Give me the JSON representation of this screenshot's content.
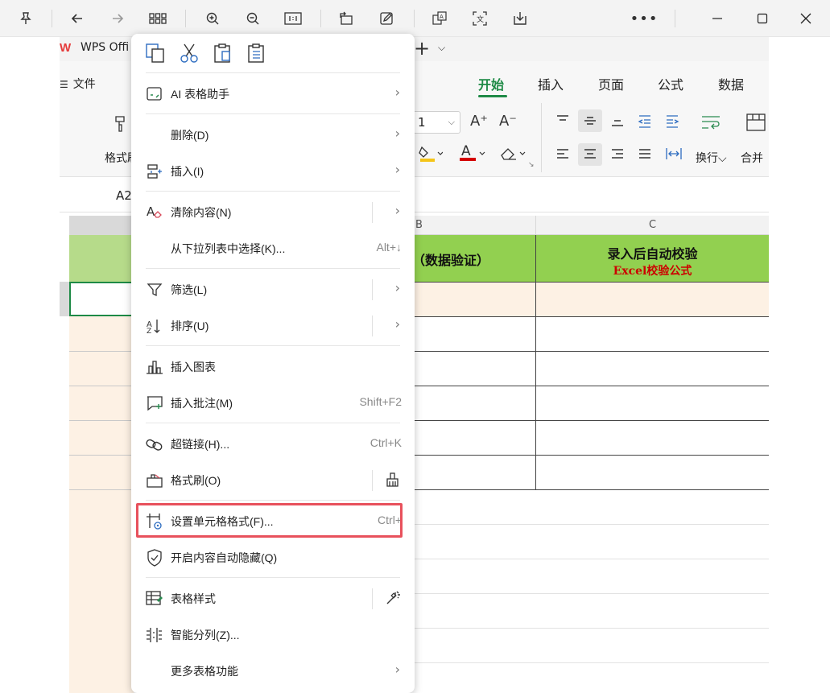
{
  "viewer": {
    "icons": [
      "pin-icon",
      "back-icon",
      "forward-icon",
      "grid-icon",
      "zoom-in-icon",
      "zoom-out-icon",
      "actual-size-icon",
      "rotate-icon",
      "edit-icon",
      "translate-icon",
      "ocr-icon",
      "save-icon",
      "more-icon"
    ]
  },
  "app": {
    "tab_label": "WPS Offi",
    "file_menu": "文件",
    "ribbon_tabs": [
      "开始",
      "插入",
      "页面",
      "公式",
      "数据"
    ],
    "active_tab": "开始",
    "format_painter_label": "格式刷",
    "font_size": "1",
    "wrap_label": "换行",
    "merge_label": "合并",
    "name_box": "A2"
  },
  "grid": {
    "columns": [
      "B",
      "C"
    ],
    "header_b": "（数据验证）",
    "header_c_title": "录入后自动校验",
    "header_c_sub": "Excel校验公式"
  },
  "context_menu": {
    "items": [
      {
        "label": "AI 表格助手",
        "icon": "ai-assistant-icon",
        "arrow": "›"
      },
      {
        "label": "删除(D)",
        "icon": "",
        "arrow": "›"
      },
      {
        "label": "插入(I)",
        "icon": "insert-icon",
        "arrow": "›"
      },
      {
        "label": "清除内容(N)",
        "icon": "clear-icon",
        "arrow": "›"
      },
      {
        "label": "从下拉列表中选择(K)...",
        "icon": "",
        "shortcut": "Alt+↓"
      },
      {
        "label": "筛选(L)",
        "icon": "filter-icon",
        "arrow": "›"
      },
      {
        "label": "排序(U)",
        "icon": "sort-icon",
        "arrow": "›"
      },
      {
        "label": "插入图表",
        "icon": "chart-icon"
      },
      {
        "label": "插入批注(M)",
        "icon": "comment-icon",
        "shortcut": "Shift+F2"
      },
      {
        "label": "超链接(H)...",
        "icon": "link-icon",
        "shortcut": "Ctrl+K"
      },
      {
        "label": "格式刷(O)",
        "icon": "format-painter-icon"
      },
      {
        "label": "设置单元格格式(F)...",
        "icon": "format-cells-icon",
        "shortcut": "Ctrl+"
      },
      {
        "label": "开启内容自动隐藏(Q)",
        "icon": "shield-icon"
      },
      {
        "label": "表格样式",
        "icon": "table-style-icon"
      },
      {
        "label": "智能分列(Z)...",
        "icon": "split-columns-icon"
      },
      {
        "label": "更多表格功能",
        "icon": "",
        "arrow": "›"
      }
    ]
  },
  "colors": {
    "accent": "#1e8a46",
    "header_green": "#92d050",
    "highlight_red": "#e8515c",
    "cell_fill": "#fdf1e4"
  }
}
